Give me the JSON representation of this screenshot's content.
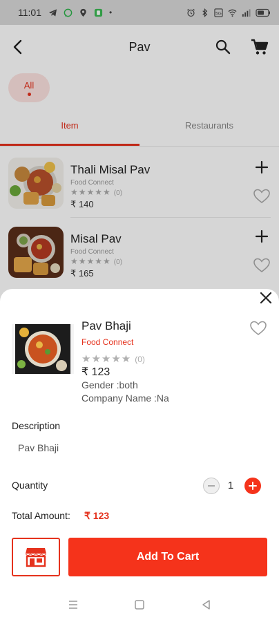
{
  "status_bar": {
    "time": "11:01",
    "left_icons": [
      "telegram-icon",
      "whatsapp-icon",
      "location-icon",
      "app-icon"
    ],
    "dot": "•",
    "right_icons": [
      "alarm-icon",
      "bluetooth-icon",
      "data-icon",
      "wifi-icon",
      "signal-icon",
      "battery-icon"
    ]
  },
  "app_bar": {
    "title": "Pav",
    "back_icon": "arrow-back-icon",
    "search_icon": "search-icon",
    "cart_icon": "cart-icon"
  },
  "filter": {
    "chip_label": "All"
  },
  "tabs": [
    {
      "label": "Item",
      "active": true
    },
    {
      "label": "Restaurants",
      "active": false
    }
  ],
  "products": [
    {
      "name": "Thali Misal Pav",
      "restaurant": "Food Connect",
      "stars": "★★★★★",
      "rating_count": "(0)",
      "price": "₹ 140"
    },
    {
      "name": "Misal Pav",
      "restaurant": "Food Connect",
      "stars": "★★★★★",
      "rating_count": "(0)",
      "price": "₹ 165"
    }
  ],
  "sheet": {
    "name": "Pav Bhaji",
    "restaurant": "Food Connect",
    "stars": "★★★★★",
    "rating_count": "(0)",
    "price": "₹ 123",
    "gender": "Gender :both",
    "company": "Company Name :Na",
    "description_label": "Description",
    "description": "Pav Bhaji",
    "quantity_label": "Quantity",
    "quantity": "1",
    "total_label": "Total Amount:",
    "total_value": "₹ 123",
    "add_to_cart": "Add To Cart"
  },
  "colors": {
    "accent": "#f5331b",
    "accent_text": "#e5321d",
    "chip_bg": "#fde3e1"
  }
}
